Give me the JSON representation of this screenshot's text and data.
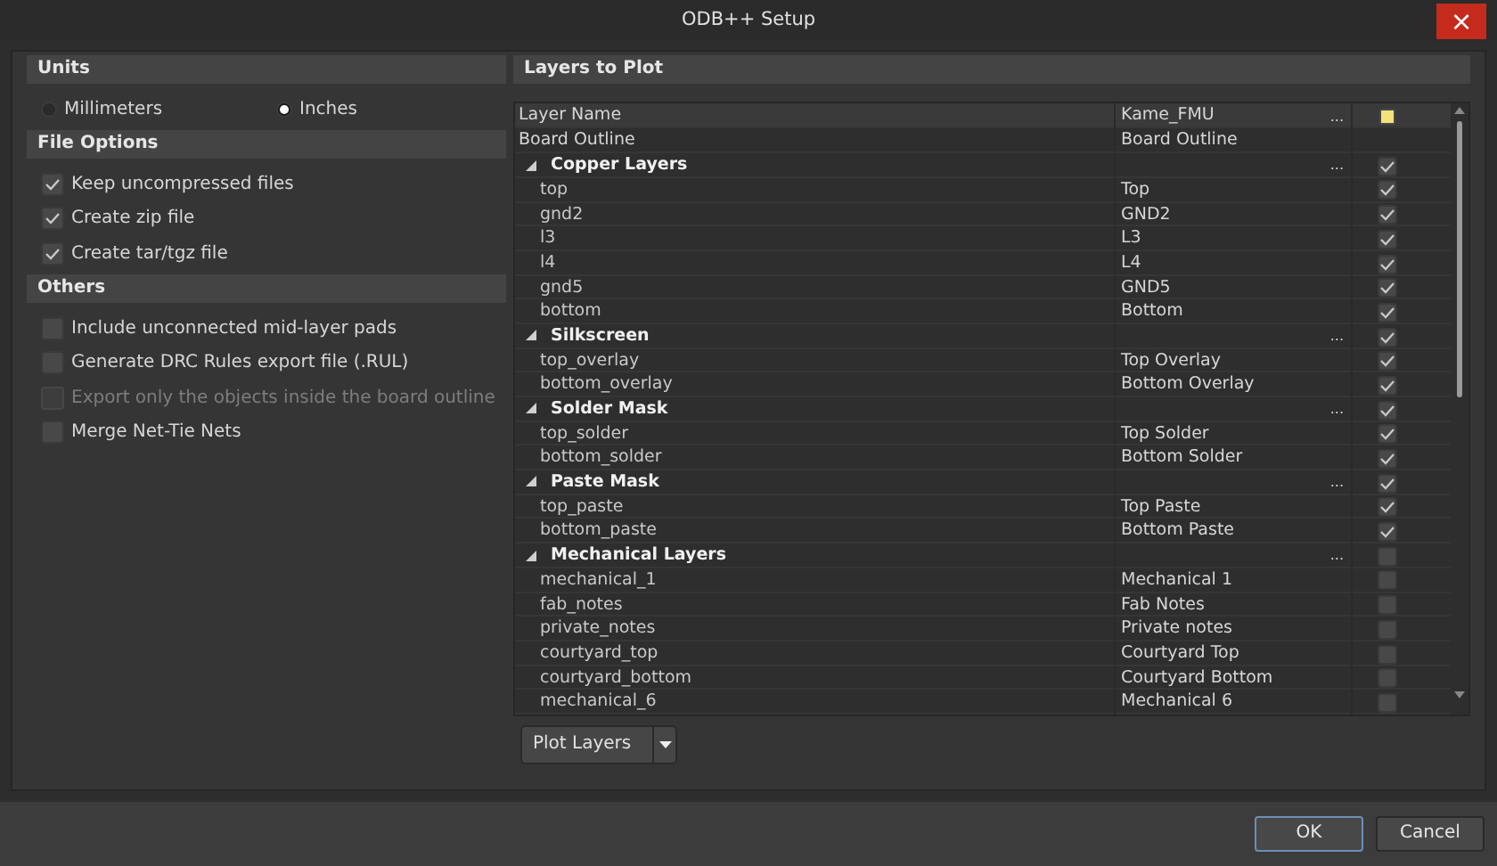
{
  "window": {
    "title": "ODB++ Setup",
    "close": "×"
  },
  "units": {
    "title": "Units",
    "options": [
      {
        "label": "Millimeters",
        "selected": false
      },
      {
        "label": "Inches",
        "selected": true
      }
    ]
  },
  "file_options": {
    "title": "File Options",
    "items": [
      {
        "label": "Keep uncompressed files",
        "checked": true
      },
      {
        "label": "Create zip file",
        "checked": true
      },
      {
        "label": "Create tar/tgz file",
        "checked": true
      }
    ]
  },
  "others": {
    "title": "Others",
    "items": [
      {
        "label": "Include unconnected mid-layer pads",
        "checked": false,
        "disabled": false
      },
      {
        "label": "Generate DRC Rules export file (.RUL)",
        "checked": false,
        "disabled": false
      },
      {
        "label": "Export only the objects inside the board outline",
        "checked": false,
        "disabled": true
      },
      {
        "label": "Merge Net-Tie Nets",
        "checked": false,
        "disabled": false
      }
    ]
  },
  "layers": {
    "title": "Layers to Plot",
    "columns": [
      "Layer Name",
      "Kame_FMU"
    ],
    "header_menu": "...",
    "header_mixed": true,
    "rows": [
      {
        "kind": "plain",
        "name": "Board Outline",
        "value": "Board Outline"
      },
      {
        "kind": "group",
        "name": "Copper Layers",
        "menu": "...",
        "expanded": true,
        "checked": true,
        "children": [
          {
            "name": "top",
            "value": "Top",
            "checked": true
          },
          {
            "name": "gnd2",
            "value": "GND2",
            "checked": true
          },
          {
            "name": "l3",
            "value": "L3",
            "checked": true
          },
          {
            "name": "l4",
            "value": "L4",
            "checked": true
          },
          {
            "name": "gnd5",
            "value": "GND5",
            "checked": true
          },
          {
            "name": "bottom",
            "value": "Bottom",
            "checked": true
          }
        ]
      },
      {
        "kind": "group",
        "name": "Silkscreen",
        "menu": "...",
        "expanded": true,
        "checked": true,
        "children": [
          {
            "name": "top_overlay",
            "value": "Top Overlay",
            "checked": true
          },
          {
            "name": "bottom_overlay",
            "value": "Bottom Overlay",
            "checked": true
          }
        ]
      },
      {
        "kind": "group",
        "name": "Solder Mask",
        "menu": "...",
        "expanded": true,
        "checked": true,
        "children": [
          {
            "name": "top_solder",
            "value": "Top Solder",
            "checked": true
          },
          {
            "name": "bottom_solder",
            "value": "Bottom Solder",
            "checked": true
          }
        ]
      },
      {
        "kind": "group",
        "name": "Paste Mask",
        "menu": "...",
        "expanded": true,
        "checked": true,
        "children": [
          {
            "name": "top_paste",
            "value": "Top Paste",
            "checked": true
          },
          {
            "name": "bottom_paste",
            "value": "Bottom Paste",
            "checked": true
          }
        ]
      },
      {
        "kind": "group",
        "name": "Mechanical Layers",
        "menu": "...",
        "expanded": true,
        "checked": false,
        "children": [
          {
            "name": "mechanical_1",
            "value": "Mechanical 1",
            "checked": false
          },
          {
            "name": "fab_notes",
            "value": "Fab Notes",
            "checked": false
          },
          {
            "name": "private_notes",
            "value": "Private notes",
            "checked": false
          },
          {
            "name": "courtyard_top",
            "value": "Courtyard Top",
            "checked": false
          },
          {
            "name": "courtyard_bottom",
            "value": "Courtyard Bottom",
            "checked": false
          },
          {
            "name": "mechanical_6",
            "value": "Mechanical 6",
            "checked": false
          }
        ]
      }
    ],
    "plot_button": "Plot Layers"
  },
  "buttons": [
    {
      "label": "OK",
      "default": true
    },
    {
      "label": "Cancel",
      "default": false
    }
  ]
}
